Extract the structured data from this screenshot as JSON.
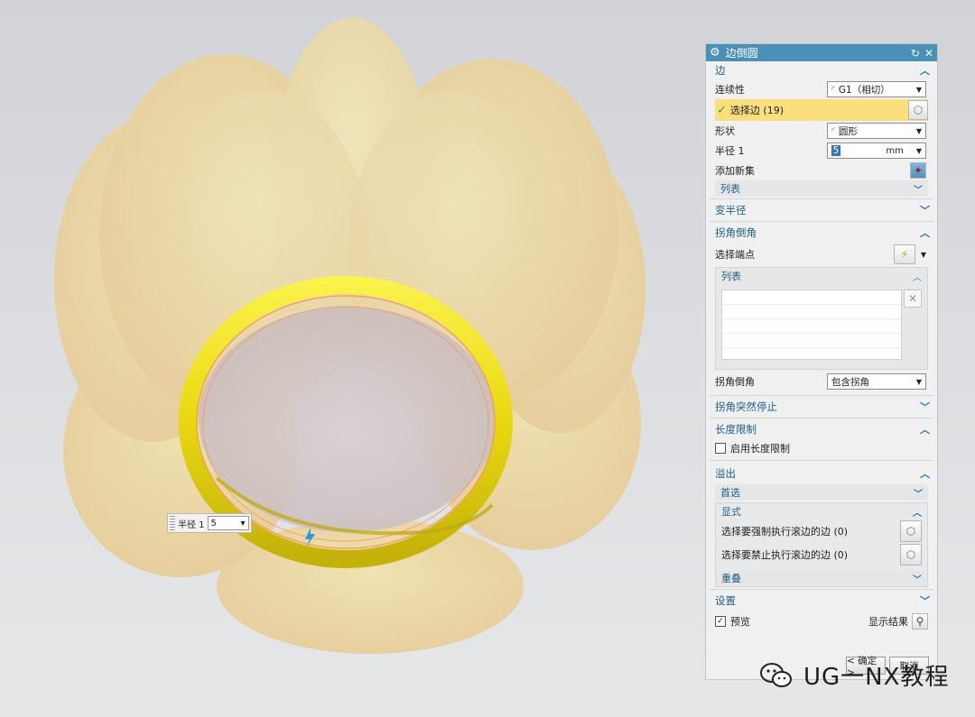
{
  "dialog": {
    "title": "边倒圆",
    "sections": {
      "edge": {
        "header": "边",
        "continuity_label": "连续性",
        "continuity_value": "G1（相切）",
        "select_edge_label": "选择边 (19)",
        "shape_label": "形状",
        "shape_value": "圆形",
        "radius_label": "半径 1",
        "radius_value": "5",
        "radius_unit": "mm",
        "add_new_set_label": "添加新集",
        "list_label": "列表"
      },
      "variable_radius": {
        "header": "变半径"
      },
      "corner_setback": {
        "header": "拐角倒角",
        "select_endpoint_label": "选择端点",
        "list_label": "列表",
        "corner_label": "拐角倒角",
        "corner_value": "包含拐角"
      },
      "corner_abrupt_stop": {
        "header": "拐角突然停止"
      },
      "length_limit": {
        "header": "长度限制",
        "enable_label": "启用长度限制",
        "enabled": false
      },
      "overflow": {
        "header": "溢出",
        "preferred_label": "首选",
        "explicit_label": "显式",
        "force_roll_label": "选择要强制执行滚边的边 (0)",
        "prohibit_roll_label": "选择要禁止执行滚边的边 (0)",
        "overlap_label": "重叠"
      },
      "settings": {
        "header": "设置"
      }
    },
    "preview_label": "预览",
    "preview_checked": true,
    "show_result_label": "显示结果",
    "ok_label": "< 确定 >",
    "cancel_label": "取消"
  },
  "onscreen_input": {
    "label": "半径 1",
    "value": "5"
  },
  "watermark": "UG一NX教程",
  "colors": {
    "title_bar": "#4a8fb6",
    "section_header_text": "#1f5d86",
    "selected_row": "#fbdf7e",
    "model_body": "#f1d79a",
    "selected_edges": "#f6e61a"
  }
}
